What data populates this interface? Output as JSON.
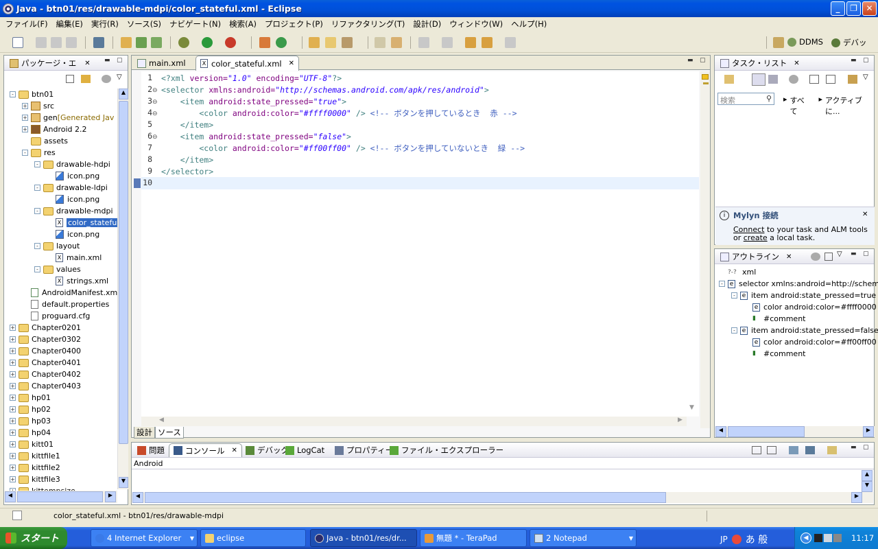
{
  "window": {
    "title": "Java - btn01/res/drawable-mdpi/color_stateful.xml - Eclipse"
  },
  "menu": [
    "ファイル(F)",
    "編集(E)",
    "実行(R)",
    "ソース(S)",
    "ナビゲート(N)",
    "検索(A)",
    "プロジェクト(P)",
    "リファクタリング(T)",
    "設計(D)",
    "ウィンドウ(W)",
    "ヘルプ(H)"
  ],
  "perspectives": {
    "ddms": "DDMS",
    "debug": "デバッ"
  },
  "package_explorer": {
    "tab": "パッケージ・エ",
    "tree": [
      {
        "label": "btn01",
        "extra": ""
      },
      {
        "label": "src",
        "extra": ""
      },
      {
        "label": "gen",
        "extra": "[Generated Jav"
      },
      {
        "label": "Android 2.2",
        "extra": ""
      },
      {
        "label": "assets",
        "extra": ""
      },
      {
        "label": "res",
        "extra": ""
      },
      {
        "label": "drawable-hdpi",
        "extra": ""
      },
      {
        "label": "icon.png",
        "extra": ""
      },
      {
        "label": "drawable-ldpi",
        "extra": ""
      },
      {
        "label": "icon.png",
        "extra": ""
      },
      {
        "label": "drawable-mdpi",
        "extra": ""
      },
      {
        "label": "color_statefu",
        "extra": ""
      },
      {
        "label": "icon.png",
        "extra": ""
      },
      {
        "label": "layout",
        "extra": ""
      },
      {
        "label": "main.xml",
        "extra": ""
      },
      {
        "label": "values",
        "extra": ""
      },
      {
        "label": "strings.xml",
        "extra": ""
      },
      {
        "label": "AndroidManifest.xm",
        "extra": ""
      },
      {
        "label": "default.properties",
        "extra": ""
      },
      {
        "label": "proguard.cfg",
        "extra": ""
      },
      {
        "label": "Chapter0201",
        "extra": ""
      },
      {
        "label": "Chapter0302",
        "extra": ""
      },
      {
        "label": "Chapter0400",
        "extra": ""
      },
      {
        "label": "Chapter0401",
        "extra": ""
      },
      {
        "label": "Chapter0402",
        "extra": ""
      },
      {
        "label": "Chapter0403",
        "extra": ""
      },
      {
        "label": "hp01",
        "extra": ""
      },
      {
        "label": "hp02",
        "extra": ""
      },
      {
        "label": "hp03",
        "extra": ""
      },
      {
        "label": "hp04",
        "extra": ""
      },
      {
        "label": "kitt01",
        "extra": ""
      },
      {
        "label": "kittfile1",
        "extra": ""
      },
      {
        "label": "kittfile2",
        "extra": ""
      },
      {
        "label": "kittfile3",
        "extra": ""
      },
      {
        "label": "kittempsize",
        "extra": ""
      }
    ]
  },
  "editor": {
    "tabs": [
      "main.xml",
      "color_stateful.xml"
    ],
    "line_numbers": [
      "1",
      "2",
      "3",
      "4",
      "5",
      "6",
      "7",
      "8",
      "9",
      "10"
    ],
    "lines": [
      {
        "parts": [
          {
            "t": "<?xml ",
            "c": "tag"
          },
          {
            "t": "version=",
            "c": "attr"
          },
          {
            "t": "\"1.0\"",
            "c": "str"
          },
          {
            "t": " encoding=",
            "c": "attr"
          },
          {
            "t": "\"UTF-8\"",
            "c": "str"
          },
          {
            "t": "?>",
            "c": "tag"
          }
        ]
      },
      {
        "parts": [
          {
            "t": "<selector ",
            "c": "tag"
          },
          {
            "t": "xmlns:android=",
            "c": "attr"
          },
          {
            "t": "\"http://schemas.android.com/apk/res/android\"",
            "c": "str"
          },
          {
            "t": ">",
            "c": "tag"
          }
        ]
      },
      {
        "parts": [
          {
            "t": "    <item ",
            "c": "tag"
          },
          {
            "t": "android:state_pressed=",
            "c": "attr"
          },
          {
            "t": "\"true\"",
            "c": "str"
          },
          {
            "t": ">",
            "c": "tag"
          }
        ]
      },
      {
        "parts": [
          {
            "t": "        <color ",
            "c": "tag"
          },
          {
            "t": "android:color=",
            "c": "attr"
          },
          {
            "t": "\"#ffff0000\"",
            "c": "str"
          },
          {
            "t": " />",
            "c": "tag"
          },
          {
            "t": " <!-- ボタンを押しているとき  赤 -->",
            "c": "cmt"
          }
        ]
      },
      {
        "parts": [
          {
            "t": "    </item>",
            "c": "tag"
          }
        ]
      },
      {
        "parts": [
          {
            "t": "    <item ",
            "c": "tag"
          },
          {
            "t": "android:state_pressed=",
            "c": "attr"
          },
          {
            "t": "\"false\"",
            "c": "str"
          },
          {
            "t": ">",
            "c": "tag"
          }
        ]
      },
      {
        "parts": [
          {
            "t": "        <color ",
            "c": "tag"
          },
          {
            "t": "android:color=",
            "c": "attr"
          },
          {
            "t": "\"#ff00ff00\"",
            "c": "str"
          },
          {
            "t": " />",
            "c": "tag"
          },
          {
            "t": " <!-- ボタンを押していないとき  緑 -->",
            "c": "cmt"
          }
        ]
      },
      {
        "parts": [
          {
            "t": "    </item>",
            "c": "tag"
          }
        ]
      },
      {
        "parts": [
          {
            "t": "</selector>",
            "c": "tag"
          }
        ]
      },
      {
        "parts": []
      }
    ],
    "bottom_tabs": [
      "設計",
      "ソース"
    ]
  },
  "task_list": {
    "tab": "タスク・リスト",
    "search_placeholder": "検索",
    "filter_all": "すべて",
    "filter_active": "アクティブに..."
  },
  "mylyn": {
    "title": "Mylyn  接続",
    "connect": "Connect",
    "line1_rest": " to your task and ALM tools",
    "line2_pre": "or ",
    "create": "create",
    "line2_rest": " a local task."
  },
  "outline": {
    "tab": "アウトライン",
    "items": [
      "xml",
      "selector xmlns:android=http://schem",
      "item android:state_pressed=true",
      "color android:color=#ffff0000",
      "#comment",
      "item android:state_pressed=false",
      "color android:color=#ff00ff00",
      "#comment"
    ]
  },
  "bottom_panel": {
    "tabs": [
      "問題",
      "コンソール",
      "デバッグ",
      "LogCat",
      "プロパティー",
      "ファイル・エクスプローラー"
    ],
    "console_label": "Android"
  },
  "status_bar": {
    "text": "color_stateful.xml - btn01/res/drawable-mdpi"
  },
  "taskbar": {
    "start": "スタート",
    "items": [
      "4 Internet Explorer",
      "eclipse",
      "Java - btn01/res/dr...",
      "無題 * - TeraPad",
      "2 Notepad"
    ],
    "lang": "JP",
    "ime": "あ 般",
    "clock": "11:17"
  }
}
